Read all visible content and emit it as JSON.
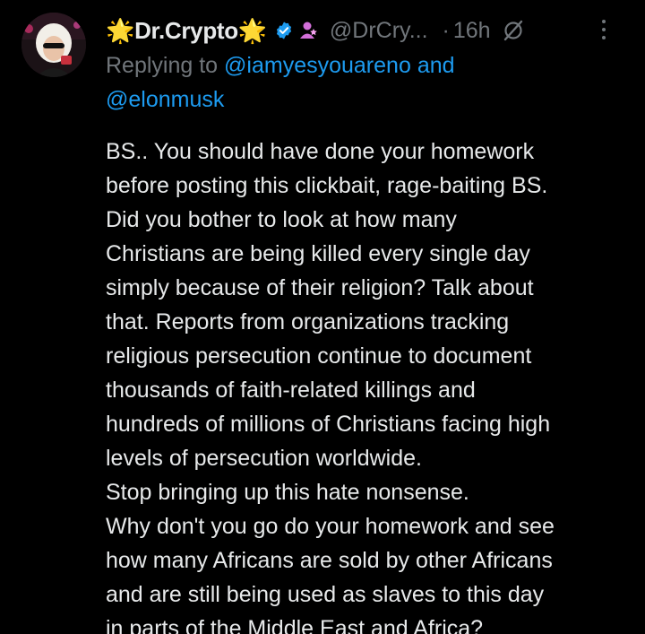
{
  "author": {
    "display_name": "Dr.Crypto",
    "name_emoji_left": "🌟",
    "name_emoji_right": "🌟",
    "handle": "@DrCry...",
    "separator": "·",
    "time": "16h"
  },
  "reply_context": {
    "prefix": "Replying to",
    "mention_1": "@iamyesyouareno",
    "joiner": "and",
    "mention_2": "@elonmusk"
  },
  "body_lines": [
    "BS.. You should have done your homework",
    "before posting this clickbait, rage-baiting BS.",
    "Did you bother to look at how many",
    "Christians are being killed every single day",
    "simply because of their religion? Talk about",
    "that. Reports from organizations tracking",
    "religious persecution continue to document",
    "thousands of faith-related killings and",
    "hundreds of millions of Christians facing high",
    "levels of persecution worldwide.",
    "Stop bringing up this hate nonsense.",
    "Why don't you go do your homework and see",
    "how many Africans are sold by other Africans",
    "and are still being used as slaves to this day",
    "in parts of the Middle East and Africa?"
  ],
  "colors": {
    "background": "#000000",
    "text_primary": "#e7e9ea",
    "text_secondary": "#71767b",
    "accent_blue": "#1d9bf0",
    "affiliate_pink": "#d36fd9"
  },
  "icons": {
    "verified": "verified-badge-icon",
    "affiliate": "affiliate-user-icon",
    "grok": "grok-icon",
    "more": "more-options-icon"
  }
}
